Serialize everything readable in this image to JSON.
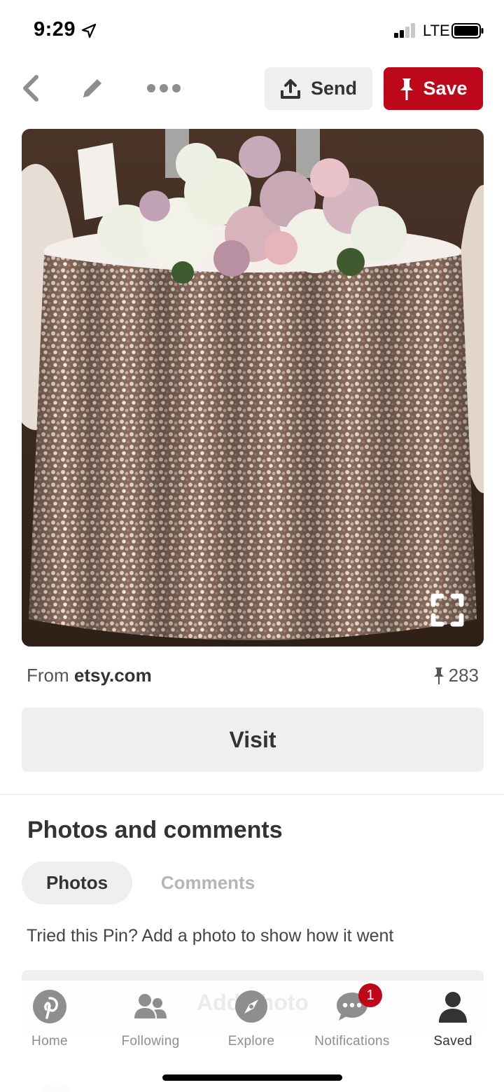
{
  "status_bar": {
    "time": "9:29",
    "carrier": "LTE",
    "location_icon": "location-arrow-icon",
    "signal_icon": "signal-bars-icon",
    "battery_icon": "battery-icon"
  },
  "toolbar": {
    "back_icon": "chevron-left-icon",
    "edit_icon": "pencil-icon",
    "more_icon": "ellipsis-icon",
    "send_label": "Send",
    "save_label": "Save",
    "save_color": "#bd081c"
  },
  "pin": {
    "image_icon": "expand-icon",
    "source_prefix": "From ",
    "source_domain": "etsy.com",
    "save_count": "283",
    "visit_label": "Visit"
  },
  "comments_section": {
    "title": "Photos and comments",
    "tabs": [
      {
        "label": "Photos",
        "active": true
      },
      {
        "label": "Comments",
        "active": false
      }
    ],
    "tried_text": "Tried this Pin? Add a photo to show how it went",
    "add_photo_label": "Add photo"
  },
  "bottom_nav": {
    "items": [
      {
        "label": "Home",
        "icon": "pinterest-logo-icon"
      },
      {
        "label": "Following",
        "icon": "people-icon"
      },
      {
        "label": "Explore",
        "icon": "compass-icon"
      },
      {
        "label": "Notifications",
        "icon": "speech-bubble-icon",
        "badge": "1"
      },
      {
        "label": "Saved",
        "icon": "person-icon",
        "active": true
      }
    ]
  }
}
